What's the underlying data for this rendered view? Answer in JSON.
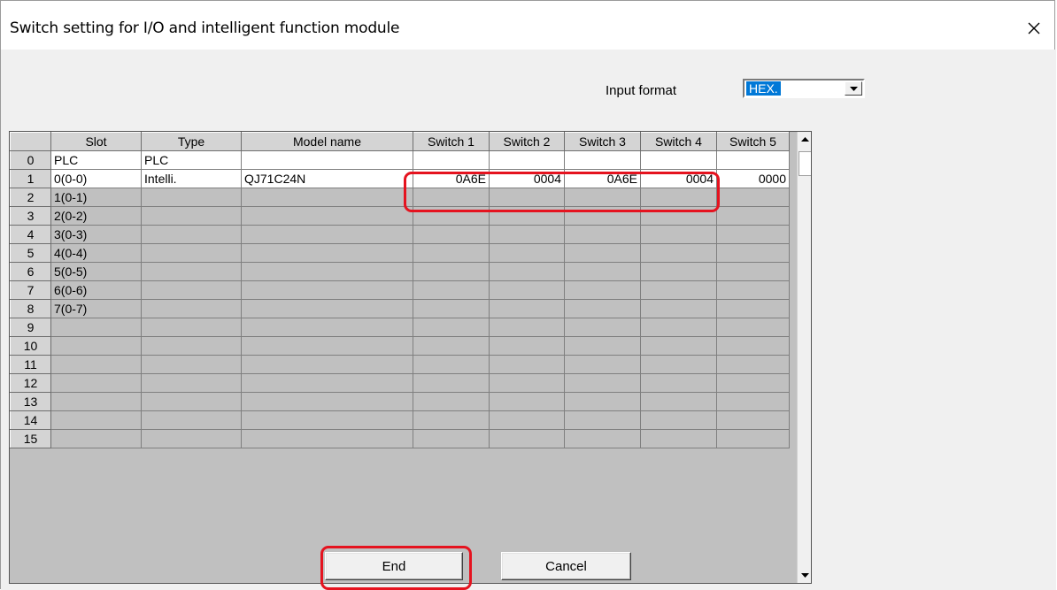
{
  "window": {
    "title": "Switch setting for I/O and intelligent function module",
    "close_icon": "close-icon"
  },
  "input_format": {
    "label": "Input format",
    "selected": "HEX."
  },
  "table": {
    "columns": [
      "",
      "Slot",
      "Type",
      "Model name",
      "Switch 1",
      "Switch 2",
      "Switch 3",
      "Switch 4",
      "Switch 5"
    ],
    "rows": [
      {
        "num": "0",
        "slot": "PLC",
        "type": "PLC",
        "model": "",
        "sw1": "",
        "sw2": "",
        "sw3": "",
        "sw4": "",
        "sw5": ""
      },
      {
        "num": "1",
        "slot": "0(0-0)",
        "type": "Intelli.",
        "model": "QJ71C24N",
        "sw1": "0A6E",
        "sw2": "0004",
        "sw3": "0A6E",
        "sw4": "0004",
        "sw5": "0000"
      },
      {
        "num": "2",
        "slot": "1(0-1)",
        "type": "",
        "model": "",
        "sw1": "",
        "sw2": "",
        "sw3": "",
        "sw4": "",
        "sw5": ""
      },
      {
        "num": "3",
        "slot": "2(0-2)",
        "type": "",
        "model": "",
        "sw1": "",
        "sw2": "",
        "sw3": "",
        "sw4": "",
        "sw5": ""
      },
      {
        "num": "4",
        "slot": "3(0-3)",
        "type": "",
        "model": "",
        "sw1": "",
        "sw2": "",
        "sw3": "",
        "sw4": "",
        "sw5": ""
      },
      {
        "num": "5",
        "slot": "4(0-4)",
        "type": "",
        "model": "",
        "sw1": "",
        "sw2": "",
        "sw3": "",
        "sw4": "",
        "sw5": ""
      },
      {
        "num": "6",
        "slot": "5(0-5)",
        "type": "",
        "model": "",
        "sw1": "",
        "sw2": "",
        "sw3": "",
        "sw4": "",
        "sw5": ""
      },
      {
        "num": "7",
        "slot": "6(0-6)",
        "type": "",
        "model": "",
        "sw1": "",
        "sw2": "",
        "sw3": "",
        "sw4": "",
        "sw5": ""
      },
      {
        "num": "8",
        "slot": "7(0-7)",
        "type": "",
        "model": "",
        "sw1": "",
        "sw2": "",
        "sw3": "",
        "sw4": "",
        "sw5": ""
      },
      {
        "num": "9",
        "slot": "",
        "type": "",
        "model": "",
        "sw1": "",
        "sw2": "",
        "sw3": "",
        "sw4": "",
        "sw5": ""
      },
      {
        "num": "10",
        "slot": "",
        "type": "",
        "model": "",
        "sw1": "",
        "sw2": "",
        "sw3": "",
        "sw4": "",
        "sw5": ""
      },
      {
        "num": "11",
        "slot": "",
        "type": "",
        "model": "",
        "sw1": "",
        "sw2": "",
        "sw3": "",
        "sw4": "",
        "sw5": ""
      },
      {
        "num": "12",
        "slot": "",
        "type": "",
        "model": "",
        "sw1": "",
        "sw2": "",
        "sw3": "",
        "sw4": "",
        "sw5": ""
      },
      {
        "num": "13",
        "slot": "",
        "type": "",
        "model": "",
        "sw1": "",
        "sw2": "",
        "sw3": "",
        "sw4": "",
        "sw5": ""
      },
      {
        "num": "14",
        "slot": "",
        "type": "",
        "model": "",
        "sw1": "",
        "sw2": "",
        "sw3": "",
        "sw4": "",
        "sw5": ""
      },
      {
        "num": "15",
        "slot": "",
        "type": "",
        "model": "",
        "sw1": "",
        "sw2": "",
        "sw3": "",
        "sw4": "",
        "sw5": ""
      }
    ]
  },
  "buttons": {
    "end": "End",
    "cancel": "Cancel"
  },
  "colors": {
    "highlight": "#e5131f",
    "selection": "#0078d7",
    "empty_cell": "#c0c0c0"
  }
}
